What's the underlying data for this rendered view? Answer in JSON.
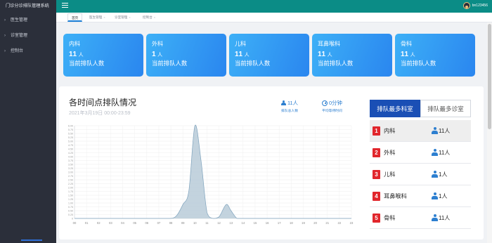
{
  "app": {
    "title": "门诊分诊排队管理系统"
  },
  "sidebar": {
    "items": [
      {
        "label": "医生管理"
      },
      {
        "label": "诊室管理"
      },
      {
        "label": "控制台"
      }
    ]
  },
  "header": {
    "username": "bn123456"
  },
  "tabs": [
    {
      "label": "首页",
      "active": true
    },
    {
      "label": "医生管理"
    },
    {
      "label": "诊室管理"
    },
    {
      "label": "控制台"
    }
  ],
  "tab_close_glyph": "×",
  "cards": [
    {
      "dept": "内科",
      "count": "11",
      "unit": "人",
      "desc": "当前排队人数"
    },
    {
      "dept": "外科",
      "count": "1",
      "unit": "人",
      "desc": "当前排队人数"
    },
    {
      "dept": "儿科",
      "count": "11",
      "unit": "人",
      "desc": "当前排队人数"
    },
    {
      "dept": "耳鼻喉科",
      "count": "11",
      "unit": "人",
      "desc": "当前排队人数"
    },
    {
      "dept": "骨科",
      "count": "11",
      "unit": "人",
      "desc": "当前排队人数"
    }
  ],
  "panel": {
    "title": "各时间点排队情况",
    "date": "2021年3月19日   00:00-23:59",
    "total_value": "11人",
    "total_label": "排队总人数",
    "wait_value": "0分钟",
    "wait_label": "平均等待时间"
  },
  "rank": {
    "tab_active": "排队最多科室",
    "tab_other": "排队最多诊室",
    "items": [
      {
        "num": "1",
        "name": "内科",
        "count": "11人"
      },
      {
        "num": "2",
        "name": "外科",
        "count": "11人"
      },
      {
        "num": "3",
        "name": "儿科",
        "count": "1人"
      },
      {
        "num": "4",
        "name": "耳鼻喉科",
        "count": "1人"
      },
      {
        "num": "5",
        "name": "骨科",
        "count": "11人"
      }
    ]
  },
  "colors": {
    "topbar": "#0b8c86",
    "card": "#2a86ef",
    "rank_badge": "#e1262c",
    "active_tab": "#1a4fb5",
    "area": "#b9cbd8"
  },
  "chart_data": {
    "type": "area",
    "x": [
      "00",
      "01",
      "02",
      "03",
      "04",
      "05",
      "06",
      "07",
      "08",
      "09",
      "10",
      "11",
      "12",
      "13",
      "14",
      "15",
      "16",
      "17",
      "18",
      "19",
      "20",
      "21",
      "22",
      "23"
    ],
    "y_ticks": [
      "0",
      "0.25",
      "0.50",
      "0.75",
      "1.00",
      "1.25",
      "1.50",
      "1.75",
      "2.00",
      "2.25",
      "2.50",
      "2.75",
      "3.00",
      "3.25",
      "3.50",
      "3.75",
      "4.00",
      "4.25",
      "4.50",
      "4.75",
      "5.00",
      "5.25",
      "5.50",
      "5.75",
      "6.00"
    ],
    "ylim": [
      0,
      6
    ],
    "series": [
      {
        "points": [
          [
            0,
            0
          ],
          [
            1,
            0
          ],
          [
            2,
            0
          ],
          [
            3,
            0
          ],
          [
            4,
            0
          ],
          [
            5,
            0
          ],
          [
            6,
            0
          ],
          [
            7,
            0
          ],
          [
            8,
            0
          ],
          [
            8.5,
            0.2
          ],
          [
            9,
            0.9
          ],
          [
            9.5,
            1.8
          ],
          [
            10,
            6.0
          ],
          [
            10.5,
            3.8
          ],
          [
            11,
            0.4
          ],
          [
            11.5,
            0
          ],
          [
            12,
            0.1
          ],
          [
            12.6,
            0.9
          ],
          [
            13,
            0.5
          ],
          [
            13.5,
            0
          ],
          [
            14,
            0
          ],
          [
            15,
            0
          ],
          [
            16,
            0
          ],
          [
            17,
            0
          ],
          [
            18,
            0
          ],
          [
            19,
            0
          ],
          [
            20,
            0
          ],
          [
            21,
            0
          ],
          [
            22,
            0
          ],
          [
            23,
            0
          ]
        ]
      }
    ],
    "grid": true,
    "legend": "none"
  }
}
